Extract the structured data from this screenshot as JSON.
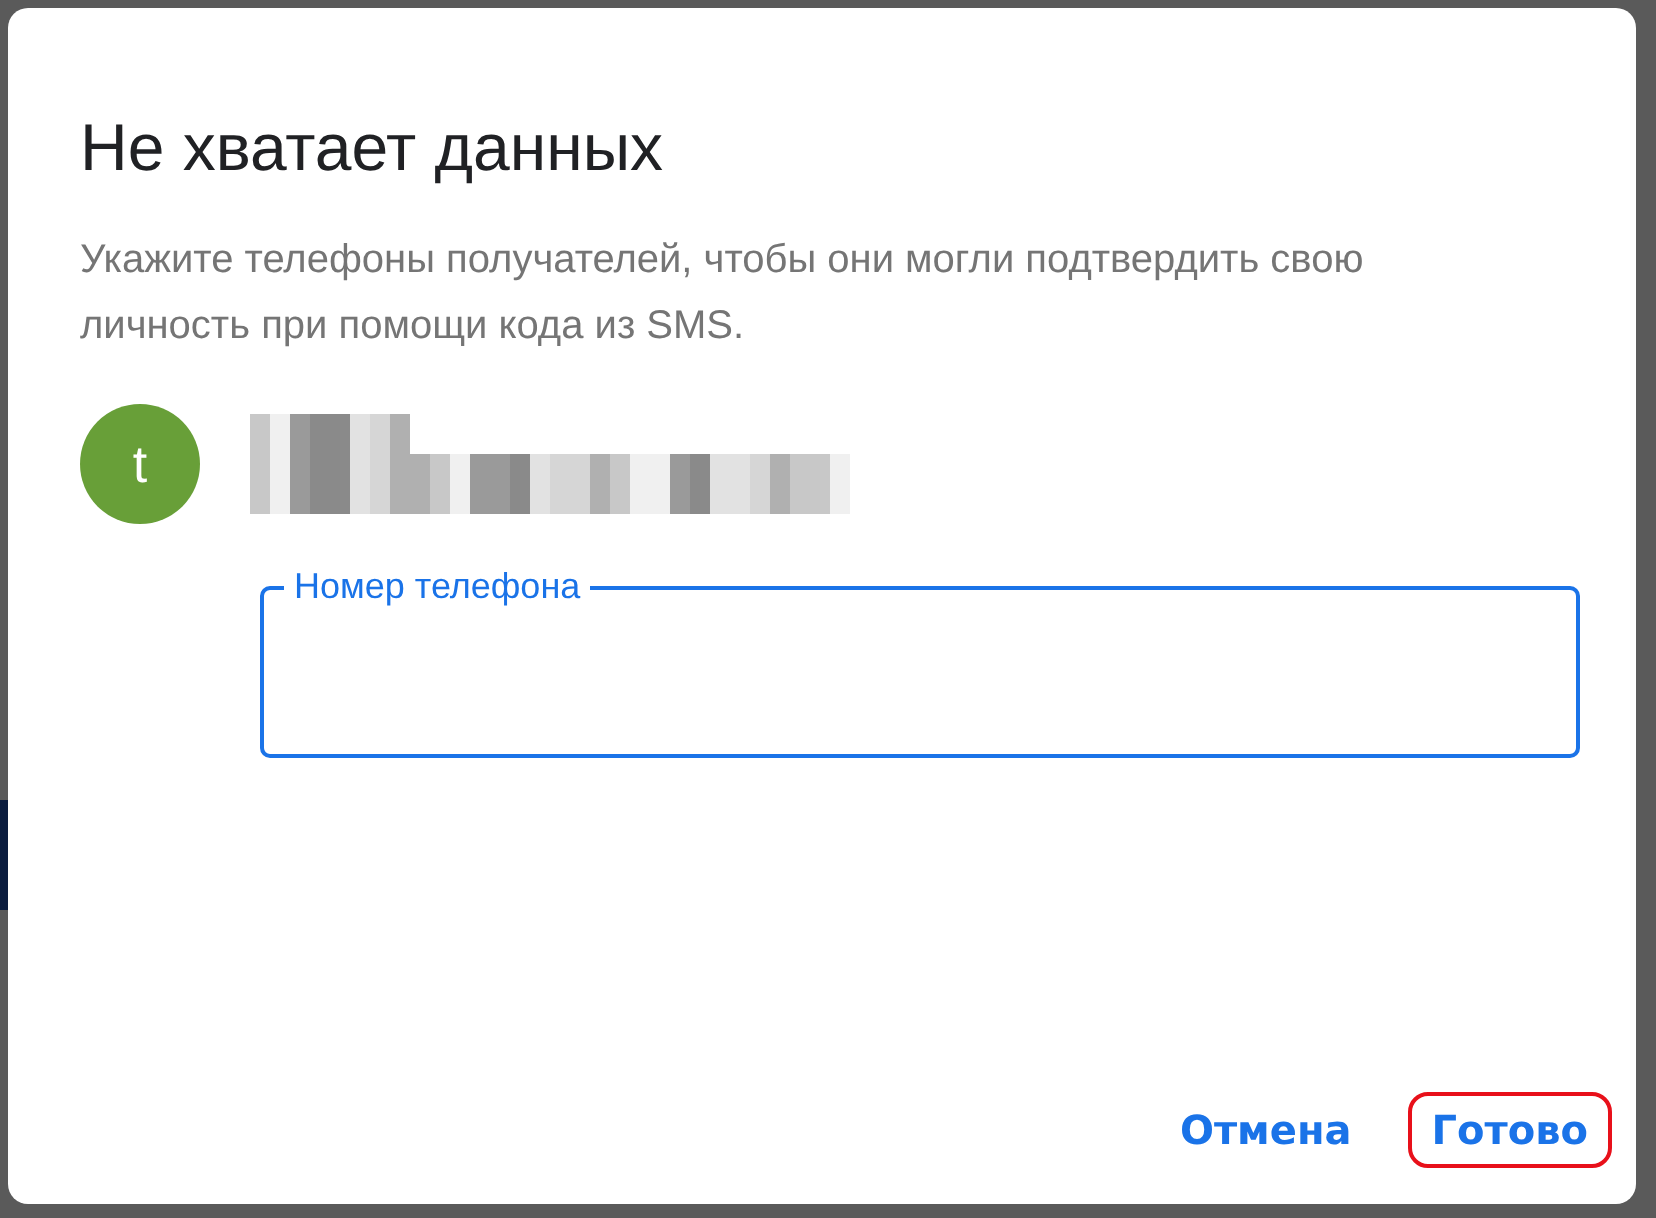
{
  "dialog": {
    "title": "Не хватает данных",
    "description": "Укажите телефоны получателей, чтобы они могли подтвердить свою личность при помощи кода из SMS.",
    "recipient": {
      "avatar_letter": "t",
      "color": "#689f38"
    },
    "phone_field": {
      "label": "Номер телефона",
      "focused": true
    },
    "buttons": [
      {
        "label": "Отмена",
        "highlighted": false
      },
      {
        "label": "Готово",
        "highlighted": true
      }
    ]
  }
}
